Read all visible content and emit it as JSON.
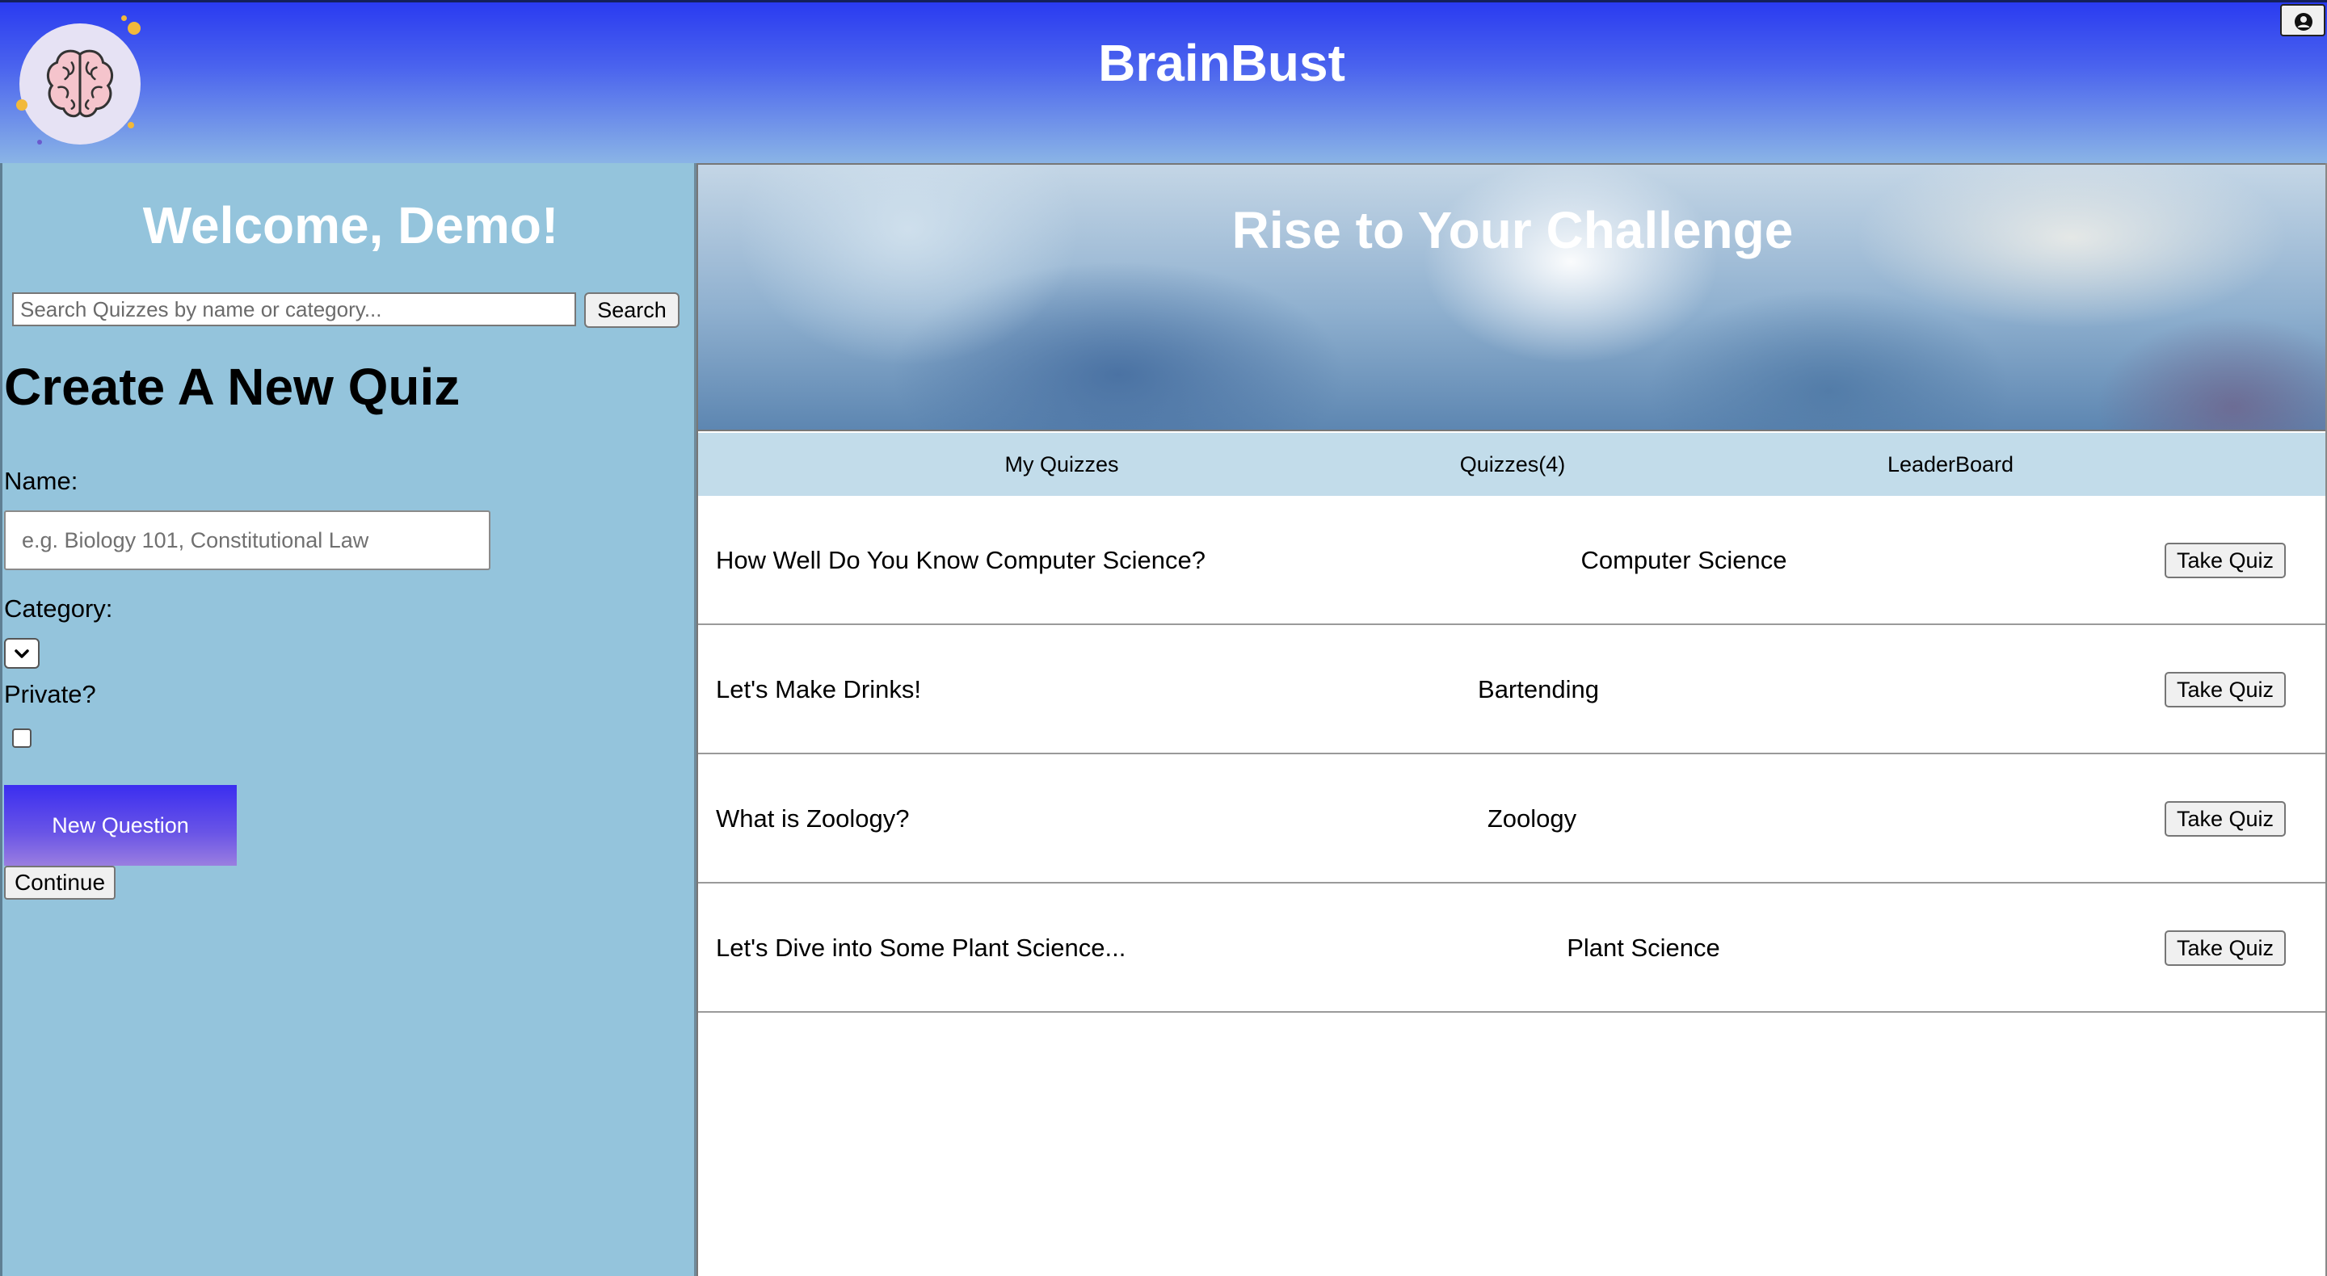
{
  "app": {
    "title": "BrainBust",
    "logo_icon": "brain-icon",
    "profile_icon": "user-circle-icon"
  },
  "sidebar": {
    "welcome": "Welcome, Demo!",
    "search": {
      "placeholder": "Search Quizzes by name or category...",
      "value": "",
      "button_label": "Search"
    },
    "create_form": {
      "title": "Create A New Quiz",
      "name_label": "Name:",
      "name_placeholder": "e.g. Biology 101, Constitutional Law",
      "name_value": "",
      "category_label": "Category:",
      "category_value": "",
      "private_label": "Private?",
      "private_checked": false,
      "new_question_label": "New Question",
      "continue_label": "Continue"
    }
  },
  "main": {
    "banner_title": "Rise to Your Challenge",
    "tabs": [
      {
        "label": "My Quizzes"
      },
      {
        "label": "Quizzes(4)"
      },
      {
        "label": "LeaderBoard"
      }
    ],
    "quizzes": [
      {
        "name": "How Well Do You Know Computer Science?",
        "category": "Computer Science",
        "action": "Take Quiz"
      },
      {
        "name": "Let's Make Drinks!",
        "category": "Bartending",
        "action": "Take Quiz"
      },
      {
        "name": "What is Zoology?",
        "category": "Zoology",
        "action": "Take Quiz"
      },
      {
        "name": "Let's Dive into Some Plant Science...",
        "category": "Plant Science",
        "action": "Take Quiz"
      }
    ]
  },
  "colors": {
    "header_top": "#2a3bf0",
    "sidebar_bg": "#94c4dc",
    "tabs_bg": "#c2dcea",
    "new_question_button": "#3b2ef0"
  }
}
